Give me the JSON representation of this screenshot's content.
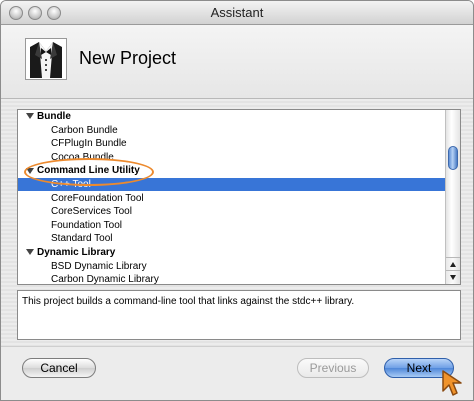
{
  "window": {
    "title": "Assistant"
  },
  "header": {
    "title": "New Project"
  },
  "project_list": {
    "items": [
      {
        "label": "Bundle",
        "kind": "group"
      },
      {
        "label": "Carbon Bundle",
        "kind": "item"
      },
      {
        "label": "CFPlugIn Bundle",
        "kind": "item"
      },
      {
        "label": "Cocoa Bundle",
        "kind": "item"
      },
      {
        "label": "Command Line Utility",
        "kind": "group"
      },
      {
        "label": "C++ Tool",
        "kind": "item",
        "selected": true
      },
      {
        "label": "CoreFoundation Tool",
        "kind": "item"
      },
      {
        "label": "CoreServices Tool",
        "kind": "item"
      },
      {
        "label": "Foundation Tool",
        "kind": "item"
      },
      {
        "label": "Standard Tool",
        "kind": "item"
      },
      {
        "label": "Dynamic Library",
        "kind": "group"
      },
      {
        "label": "BSD Dynamic Library",
        "kind": "item"
      },
      {
        "label": "Carbon Dynamic Library",
        "kind": "item"
      }
    ]
  },
  "description": {
    "text": "This project builds a command-line tool that links against the stdc++ library."
  },
  "buttons": {
    "cancel": "Cancel",
    "previous": "Previous",
    "next": "Next"
  },
  "colors": {
    "selection": "#3875d7",
    "highlight_ring": "#ec8a2e",
    "next_button": "#4f87d9"
  },
  "icons": {
    "app_icon": "tuxedo-assistant-icon",
    "cursor": "orange-pointer-cursor-icon"
  }
}
